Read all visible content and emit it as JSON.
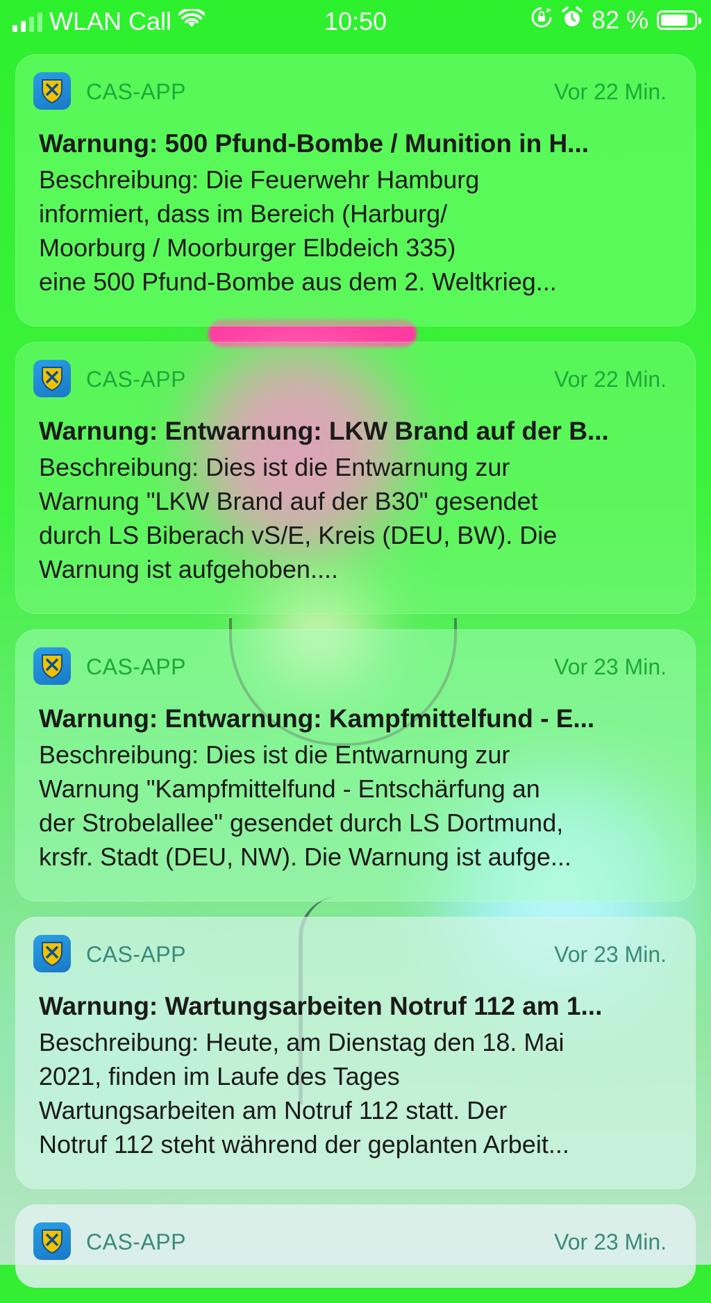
{
  "status_bar": {
    "carrier": "WLAN Call",
    "time": "10:50",
    "battery_percent": "82 %",
    "battery_level": 0.82,
    "signal_bars_filled": 2,
    "signal_bars_total": 4
  },
  "notifications": [
    {
      "app": "CAS-APP",
      "time": "Vor 22 Min.",
      "title": "Warnung: 500 Pfund-Bombe / Munition in H...",
      "lines": [
        "Beschreibung: Die Feuerwehr Hamburg",
        "informiert, dass im Bereich (Harburg/",
        "Moorburg / Moorburger Elbdeich 335)",
        "eine 500 Pfund-Bombe aus dem 2. Weltkrieg..."
      ]
    },
    {
      "app": "CAS-APP",
      "time": "Vor 22 Min.",
      "title": "Warnung: Entwarnung: LKW Brand auf der B...",
      "lines": [
        "Beschreibung: Dies ist die Entwarnung zur",
        "Warnung \"LKW Brand auf der B30\" gesendet",
        "durch LS Biberach vS/E, Kreis (DEU, BW). Die",
        "Warnung ist aufgehoben...."
      ]
    },
    {
      "app": "CAS-APP",
      "time": "Vor 23 Min.",
      "title": "Warnung: Entwarnung: Kampfmittelfund - E...",
      "lines": [
        "Beschreibung: Dies ist die Entwarnung zur",
        "Warnung \"Kampfmittelfund - Entschärfung an",
        "der Strobelallee\" gesendet durch LS Dortmund,",
        "krsfr. Stadt (DEU, NW). Die Warnung ist aufge..."
      ]
    },
    {
      "app": "CAS-APP",
      "time": "Vor 23 Min.",
      "title": "Warnung: Wartungsarbeiten Notruf 112 am 1...",
      "lines": [
        "Beschreibung: Heute, am Dienstag den 18. Mai",
        "2021, finden im Laufe des Tages",
        "Wartungsarbeiten am Notruf 112 statt. Der",
        "Notruf 112 steht während der geplanten Arbeit..."
      ]
    },
    {
      "app": "CAS-APP",
      "time": "Vor 23 Min."
    }
  ],
  "icons": {
    "app_icon": "cas-shield-icon",
    "wifi": "wifi-icon",
    "orientation_lock": "orientation-lock-icon",
    "alarm": "alarm-clock-icon",
    "battery": "battery-icon",
    "signal": "cellular-signal-icon"
  },
  "colors": {
    "wallpaper_green": "#33ee33",
    "app_name_green": "#1ea83a",
    "app_icon_blue": "#1a78c6",
    "app_icon_yellow": "#f2c200"
  }
}
